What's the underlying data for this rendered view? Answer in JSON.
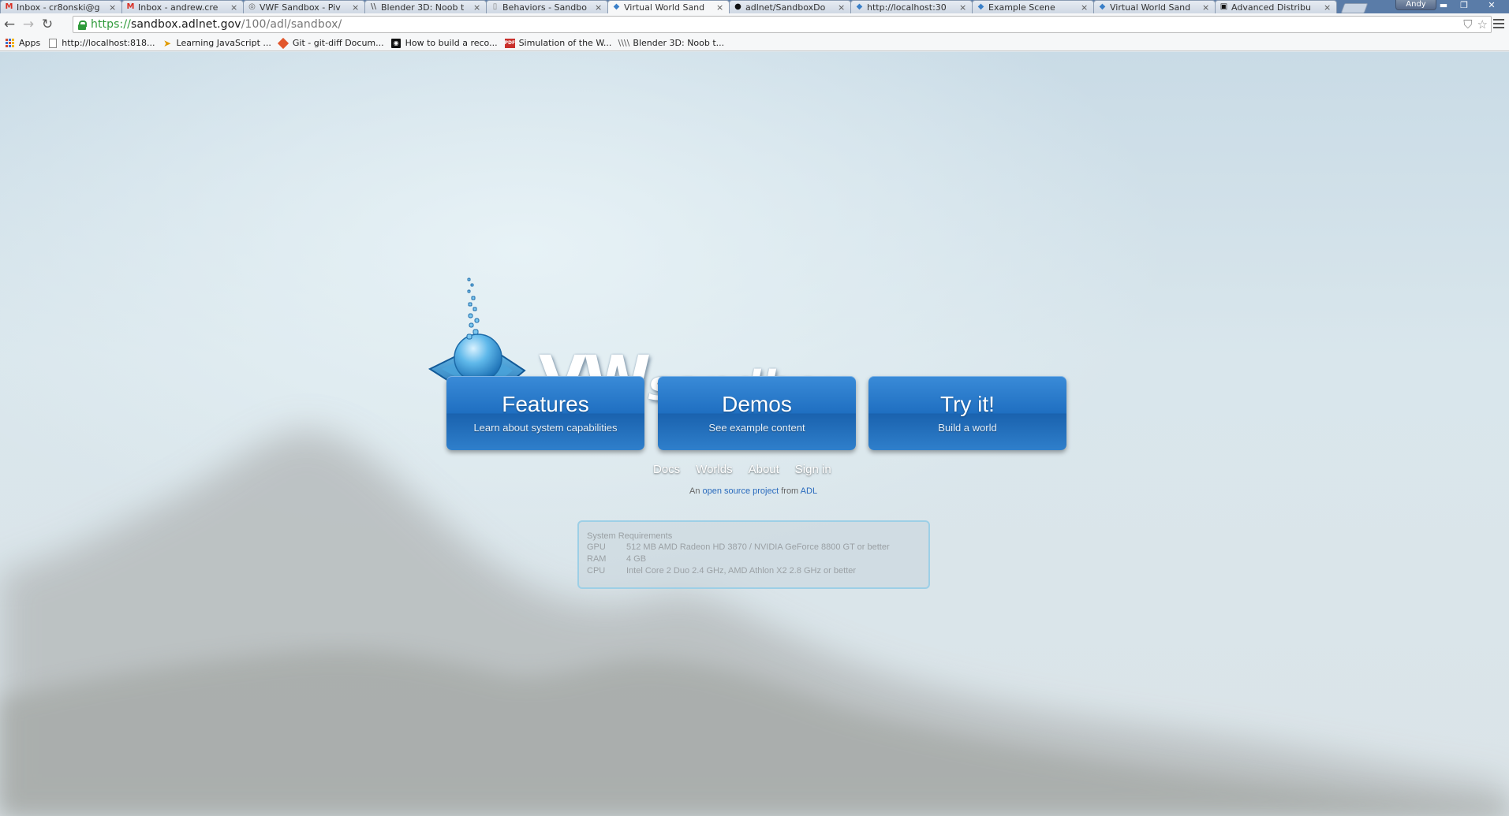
{
  "browser": {
    "tabs": [
      {
        "icon": "gmail-icon",
        "title": "Inbox - cr8onski@g",
        "active": false
      },
      {
        "icon": "gmail-icon",
        "title": "Inbox - andrew.cre",
        "active": false
      },
      {
        "icon": "github-icon",
        "title": "VWF Sandbox - Piv",
        "active": false
      },
      {
        "icon": "wikibooks-icon",
        "title": "Blender 3D: Noob t",
        "active": false
      },
      {
        "icon": "page-icon",
        "title": "Behaviors - Sandbo",
        "active": false
      },
      {
        "icon": "sandbox-icon",
        "title": "Virtual World Sand",
        "active": true
      },
      {
        "icon": "github-icon",
        "title": "adlnet/SandboxDo",
        "active": false
      },
      {
        "icon": "sandbox-icon",
        "title": "http://localhost:30",
        "active": false
      },
      {
        "icon": "sandbox-icon",
        "title": "Example Scene",
        "active": false
      },
      {
        "icon": "sandbox-icon",
        "title": "Virtual World Sand",
        "active": false
      },
      {
        "icon": "adl-icon",
        "title": "Advanced Distribu",
        "active": false
      }
    ],
    "tab_close_glyph": "×",
    "profile_name": "Andy",
    "url": {
      "scheme": "https://",
      "host": "sandbox.adlnet.gov",
      "path": "/100/adl/sandbox/"
    },
    "bookmarks": [
      {
        "icon": "apps-icon",
        "label": "Apps"
      },
      {
        "icon": "page-icon",
        "label": "http://localhost:818..."
      },
      {
        "icon": "javascript-icon",
        "label": "Learning JavaScript ..."
      },
      {
        "icon": "git-icon",
        "label": "Git - git-diff Docum..."
      },
      {
        "icon": "github-icon",
        "label": "How to build a reco..."
      },
      {
        "icon": "pdf-icon",
        "label": "Simulation of the W..."
      },
      {
        "icon": "wikibooks-icon",
        "label": "Blender 3D: Noob t..."
      }
    ]
  },
  "page": {
    "logo": {
      "word_vw": "VW",
      "word_sandbox": "sandbox"
    },
    "buttons": {
      "features": {
        "title": "Features",
        "subtitle": "Learn about system capabilities"
      },
      "demos": {
        "title": "Demos",
        "subtitle": "See example content"
      },
      "try": {
        "title": "Try it!",
        "subtitle": "Build a world"
      }
    },
    "links": {
      "docs": "Docs",
      "worlds": "Worlds",
      "about": "About",
      "signin": "Sign in"
    },
    "credit": {
      "prefix": "An",
      "link1": "open source project",
      "middle": "from",
      "link2": "ADL"
    },
    "sysreq": {
      "title": "System Requirements",
      "rows": [
        {
          "key": "GPU",
          "value": "512 MB AMD Radeon HD 3870 / NVIDIA GeForce 8800 GT or better"
        },
        {
          "key": "RAM",
          "value": "4 GB"
        },
        {
          "key": "CPU",
          "value": "Intel Core 2 Duo 2.4 GHz, AMD Athlon X2 2.8 GHz or better"
        }
      ]
    }
  }
}
